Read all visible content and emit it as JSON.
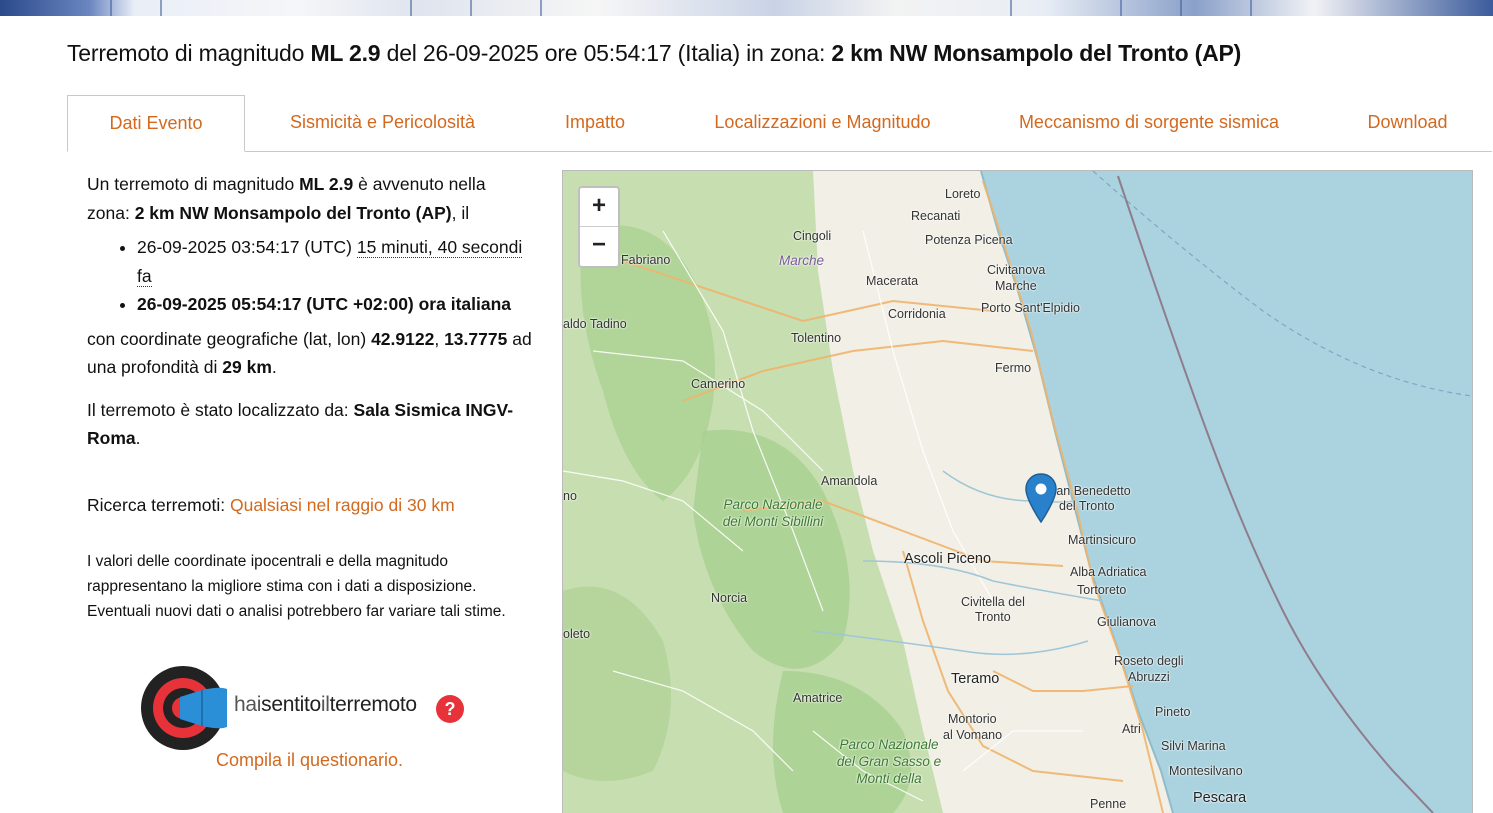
{
  "header": {
    "title_prefix": "Terremoto di magnitudo",
    "magnitude": "ML 2.9",
    "title_mid": "del 26-09-2025 ore 05:54:17 (Italia) in zona:",
    "zone": "2 km NW Monsampolo del Tronto (AP)"
  },
  "tabs": [
    {
      "label": "Dati Evento"
    },
    {
      "label": "Sismicità e Pericolosità"
    },
    {
      "label": "Impatto"
    },
    {
      "label": "Localizzazioni e Magnitudo"
    },
    {
      "label": "Meccanismo di sorgente sismica"
    },
    {
      "label": "Download"
    }
  ],
  "event": {
    "intro_a": "Un terremoto di magnitudo",
    "magnitude": "ML 2.9",
    "intro_b": "è avvenuto nella zona:",
    "zone": "2 km NW Monsampolo del Tronto (AP)",
    "intro_c": ", il",
    "utc_time": "26-09-2025 03:54:17 (UTC)",
    "time_ago": "15 minuti, 40 secondi fa",
    "local_time": "26-09-2025 05:54:17 (UTC +02:00) ora italiana",
    "coords_label": "con coordinate geografiche (lat, lon)",
    "lat": "42.9122",
    "lon": "13.7775",
    "depth_label": "ad una profondità di",
    "depth": "29 km",
    "located_label": "Il terremoto è stato localizzato da:",
    "located_by": "Sala Sismica INGV-Roma",
    "search_label": "Ricerca terremoti:",
    "search_link": "Qualsiasi nel raggio di 30 km",
    "note": "I valori delle coordinate ipocentrali e della magnitudo rappresentano la migliore stima con i dati a disposizione. Eventuali nuovi dati o analisi potrebbero far variare tali stime.",
    "hst_logo_text_a": "hai",
    "hst_logo_text_b": "sentito",
    "hst_logo_text_c": "il",
    "hst_logo_text_d": "terremoto",
    "hst_q": "?",
    "questionnaire": "Compila il questionario."
  },
  "map": {
    "zoom_in": "+",
    "zoom_out": "−",
    "places": [
      {
        "name": "Loreto"
      },
      {
        "name": "Recanati"
      },
      {
        "name": "Cingoli"
      },
      {
        "name": "Potenza Picena"
      },
      {
        "name": "Fabriano"
      },
      {
        "name": "Marche"
      },
      {
        "name": "Civitanova"
      },
      {
        "name": "Marche"
      },
      {
        "name": "Macerata"
      },
      {
        "name": "Corridonia"
      },
      {
        "name": "Porto Sant'Elpidio"
      },
      {
        "name": "aldo Tadino"
      },
      {
        "name": "Tolentino"
      },
      {
        "name": "Fermo"
      },
      {
        "name": "Camerino"
      },
      {
        "name": "Amandola"
      },
      {
        "name": "San Benedetto"
      },
      {
        "name": "del Tronto"
      },
      {
        "name": "Martinsicuro"
      },
      {
        "name": "Ascoli Piceno"
      },
      {
        "name": "Alba Adriatica"
      },
      {
        "name": "Tortoreto"
      },
      {
        "name": "Norcia"
      },
      {
        "name": "Civitella del"
      },
      {
        "name": "Tronto"
      },
      {
        "name": "Giulianova"
      },
      {
        "name": "oleto"
      },
      {
        "name": "Roseto degli"
      },
      {
        "name": "Abruzzi"
      },
      {
        "name": "Teramo"
      },
      {
        "name": "Amatrice"
      },
      {
        "name": "Pineto"
      },
      {
        "name": "Montorio"
      },
      {
        "name": "al Vomano"
      },
      {
        "name": "Atri"
      },
      {
        "name": "Silvi Marina"
      },
      {
        "name": "Montesilvano"
      },
      {
        "name": "Penne"
      },
      {
        "name": "Pescara"
      },
      {
        "name": "no"
      }
    ],
    "parks": [
      {
        "name": "Parco Nazionale dei Monti Sibillini"
      },
      {
        "name": "Parco Nazionale del Gran Sasso e Monti della"
      }
    ]
  },
  "colors": {
    "accent": "#d2691e",
    "sea": "#aad3df",
    "marker": "#2a81cb"
  }
}
